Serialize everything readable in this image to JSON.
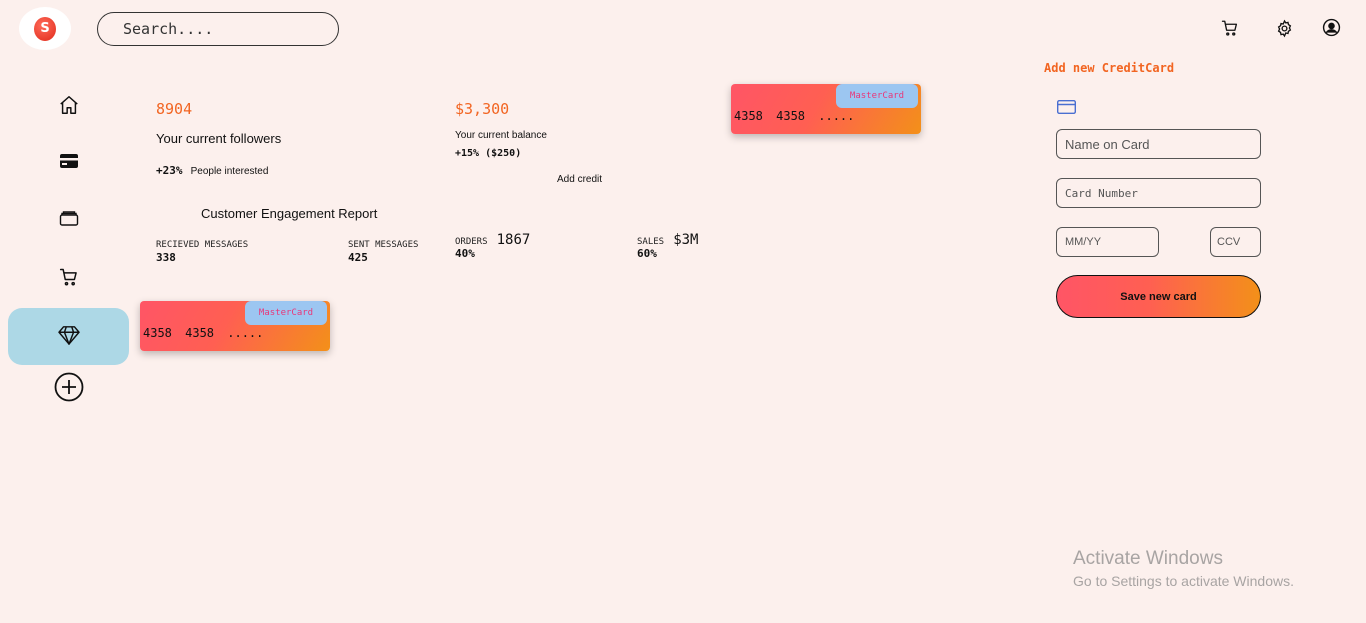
{
  "search": {
    "placeholder": "Search...."
  },
  "logo": {
    "glyph": "S"
  },
  "header_icons": [
    "cart-icon",
    "gear-icon",
    "user-account-icon"
  ],
  "sidebar": {
    "items": [
      {
        "icon": "home-icon",
        "active": false
      },
      {
        "icon": "credit-card-icon",
        "active": false
      },
      {
        "icon": "wallet-icon",
        "active": false
      },
      {
        "icon": "cart-icon",
        "active": false
      },
      {
        "icon": "diamond-icon",
        "active": true
      },
      {
        "icon": "add-circle-icon",
        "active": false
      }
    ],
    "active_color": "#add8e6"
  },
  "followers": {
    "value": "8904",
    "label": "Your current followers",
    "change": "+23%",
    "change_label": "People interested"
  },
  "balance": {
    "value": "$3,300",
    "label": "Your current balance",
    "change": "+15% ($250)",
    "add_credit": "Add credit"
  },
  "engagement": {
    "title": "Customer Engagement Report",
    "received_label": "RECIEVED MESSAGES",
    "received_value": "338",
    "sent_label": "SENT MESSAGES",
    "sent_value": "425",
    "orders_label": "ORDERS",
    "orders_value": "1867",
    "orders_pct": "40%",
    "sales_label": "SALES",
    "sales_value": "$3M",
    "sales_pct": "60%"
  },
  "cards": [
    {
      "brand": "MasterCard",
      "number": "4358 4358 ....."
    },
    {
      "brand": "MasterCard",
      "number": "4358 4358 ....."
    }
  ],
  "form": {
    "title": "Add new CreditCard",
    "name_placeholder": "Name on Card",
    "number_placeholder": "Card Number",
    "expiry_placeholder": "MM/YY",
    "ccv_placeholder": "CCV",
    "save_label": "Save new card"
  },
  "watermark": {
    "line1": "Activate Windows",
    "line2": "Go to Settings to activate Windows."
  },
  "colors": {
    "background": "#fcf0ed",
    "accent": "#f26522",
    "card_gradient_start": "#ff5566",
    "card_gradient_end": "#f39019",
    "card_brand_bg": "#9cc6f1"
  }
}
